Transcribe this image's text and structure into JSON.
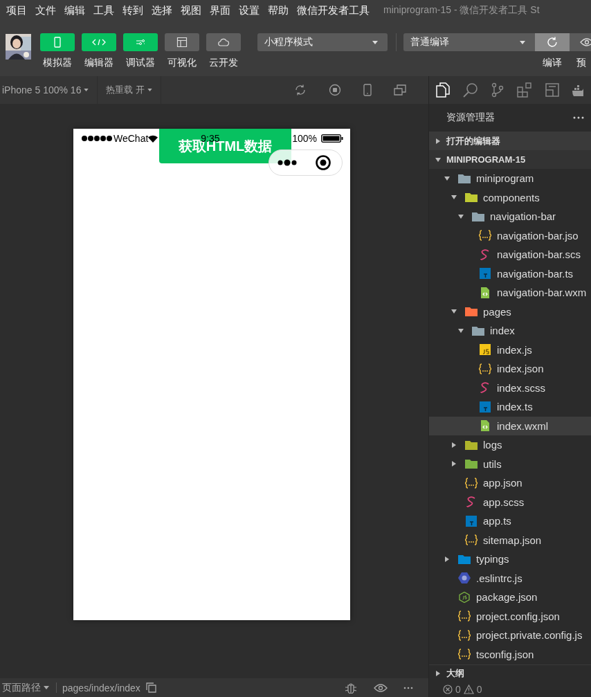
{
  "menu": [
    "项目",
    "文件",
    "编辑",
    "工具",
    "转到",
    "选择",
    "视图",
    "界面",
    "设置",
    "帮助",
    "微信开发者工具"
  ],
  "window": {
    "title": "miniprogram-15 - 微信开发者工具 St"
  },
  "toolbar": {
    "buttons": [
      {
        "label": "模拟器",
        "kind": "phone",
        "on": true
      },
      {
        "label": "编辑器",
        "kind": "code",
        "on": true
      },
      {
        "label": "调试器",
        "kind": "debug",
        "on": true
      },
      {
        "label": "可视化",
        "kind": "layout",
        "on": false
      },
      {
        "label": "云开发",
        "kind": "cloud",
        "on": false
      }
    ],
    "mode": "小程序模式",
    "compile": "普通编译",
    "actions": [
      "编译",
      "预"
    ]
  },
  "simulator_bar": {
    "device": "iPhone 5 100% 16",
    "hot_reload": "热重载 开"
  },
  "phone": {
    "carrier": "WeChat",
    "time": "9:35",
    "battery": "100%",
    "button": "获取HTML数据"
  },
  "explorer": {
    "title": "资源管理器",
    "sections": [
      {
        "label": "打开的编辑器",
        "expanded": false
      },
      {
        "label": "MINIPROGRAM-15",
        "expanded": true
      }
    ],
    "tree": [
      {
        "name": "miniprogram",
        "kind": "folder",
        "color": "#90a4ae",
        "expanded": true,
        "selected": false,
        "children": [
          {
            "name": "components",
            "kind": "folder",
            "color": "#c0ca33",
            "expanded": true,
            "selected": false,
            "children": [
              {
                "name": "navigation-bar",
                "kind": "folder",
                "color": "#90a4ae",
                "expanded": true,
                "selected": false,
                "children": [
                  {
                    "name": "navigation-bar.jso",
                    "kind": "json",
                    "selected": false
                  },
                  {
                    "name": "navigation-bar.scs",
                    "kind": "scss",
                    "selected": false
                  },
                  {
                    "name": "navigation-bar.ts",
                    "kind": "ts",
                    "selected": false
                  },
                  {
                    "name": "navigation-bar.wxm",
                    "kind": "wxml",
                    "selected": false
                  }
                ]
              }
            ]
          },
          {
            "name": "pages",
            "kind": "folder",
            "color": "#ff7043",
            "expanded": true,
            "selected": false,
            "children": [
              {
                "name": "index",
                "kind": "folder",
                "color": "#90a4ae",
                "expanded": true,
                "selected": false,
                "children": [
                  {
                    "name": "index.js",
                    "kind": "js",
                    "selected": false
                  },
                  {
                    "name": "index.json",
                    "kind": "json",
                    "selected": false
                  },
                  {
                    "name": "index.scss",
                    "kind": "scss",
                    "selected": false
                  },
                  {
                    "name": "index.ts",
                    "kind": "ts",
                    "selected": false
                  },
                  {
                    "name": "index.wxml",
                    "kind": "wxml",
                    "selected": true
                  }
                ]
              }
            ]
          },
          {
            "name": "logs",
            "kind": "folder",
            "color": "#afb42b",
            "expanded": false,
            "selected": false
          },
          {
            "name": "utils",
            "kind": "folder",
            "color": "#7cb342",
            "expanded": false,
            "selected": false
          },
          {
            "name": "app.json",
            "kind": "json",
            "selected": false
          },
          {
            "name": "app.scss",
            "kind": "scss",
            "selected": false
          },
          {
            "name": "app.ts",
            "kind": "ts",
            "selected": false
          },
          {
            "name": "sitemap.json",
            "kind": "json",
            "selected": false
          }
        ]
      },
      {
        "name": "typings",
        "kind": "folder",
        "color": "#0288d1",
        "expanded": false,
        "selected": false
      },
      {
        "name": ".eslintrc.js",
        "kind": "eslint",
        "selected": false
      },
      {
        "name": "package.json",
        "kind": "package",
        "selected": false
      },
      {
        "name": "project.config.json",
        "kind": "json",
        "selected": false
      },
      {
        "name": "project.private.config.js",
        "kind": "json",
        "selected": false
      },
      {
        "name": "tsconfig.json",
        "kind": "json",
        "selected": false
      }
    ],
    "outline": {
      "label": "大纲",
      "expanded": false
    }
  },
  "status": {
    "page_path_label": "页面路径",
    "path": "pages/index/index",
    "errors": "0",
    "warnings": "0"
  }
}
